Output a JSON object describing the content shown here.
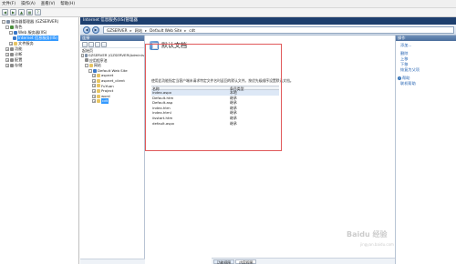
{
  "outer_menu": [
    "文件(F)",
    "操作(A)",
    "查看(V)",
    "帮助(H)"
  ],
  "left_tree": [
    {
      "label": "服务器管理器 (GZSERVER)",
      "depth": 0,
      "icon": "server-icon",
      "exp": "-"
    },
    {
      "label": "角色",
      "depth": 1,
      "icon": "role-icon",
      "exp": "-"
    },
    {
      "label": "Web 服务器(IIS)",
      "depth": 2,
      "icon": "iis-icon",
      "exp": "-"
    },
    {
      "label": "Internet 信息服务(IIS)",
      "depth": 3,
      "icon": "iis-icon",
      "exp": "",
      "selected": true
    },
    {
      "label": "文件服务",
      "depth": 2,
      "icon": "folder-icon",
      "exp": "+"
    },
    {
      "label": "功能",
      "depth": 1,
      "icon": "gear-icon",
      "exp": "+"
    },
    {
      "label": "诊断",
      "depth": 1,
      "icon": "gear-icon",
      "exp": "+"
    },
    {
      "label": "配置",
      "depth": 1,
      "icon": "gear-icon",
      "exp": "+"
    },
    {
      "label": "存储",
      "depth": 1,
      "icon": "gear-icon",
      "exp": "+"
    }
  ],
  "mmc": {
    "title": "Internet 信息服务(IIS)管理器",
    "breadcrumb": [
      "GZSERVER",
      "网站",
      "Default Web Site",
      "cdt"
    ]
  },
  "connections": {
    "header": "连接",
    "start_label": "起始页",
    "tree": [
      {
        "label": "GZSERVER (GZSERVER\\Adminis",
        "depth": 0,
        "exp": "-",
        "icon": "server-icon"
      },
      {
        "label": "应用程序池",
        "depth": 1,
        "exp": "",
        "icon": "gear-icon"
      },
      {
        "label": "网站",
        "depth": 1,
        "exp": "-",
        "icon": "folder-icon"
      },
      {
        "label": "Default Web Site",
        "depth": 2,
        "exp": "-",
        "icon": "iis-icon"
      },
      {
        "label": "aspnet",
        "depth": 3,
        "exp": "+",
        "icon": "folder-icon"
      },
      {
        "label": "aspnet_client",
        "depth": 3,
        "exp": "+",
        "icon": "folder-icon"
      },
      {
        "label": "FuYuan",
        "depth": 3,
        "exp": "+",
        "icon": "folder-icon"
      },
      {
        "label": "Project",
        "depth": 3,
        "exp": "+",
        "icon": "folder-icon"
      },
      {
        "label": "word",
        "depth": 3,
        "exp": "+",
        "icon": "folder-icon"
      },
      {
        "label": "cdt",
        "depth": 3,
        "exp": "+",
        "icon": "folder-icon",
        "selected": true
      }
    ]
  },
  "feature": {
    "title": "默认文档",
    "description": "使用此功能指定当客户端未请求特定文件名时返回的默认文件。按优先级顺序设置默认文档。",
    "columns": [
      "名称",
      "条目类型"
    ],
    "rows": [
      [
        "index.aspx",
        "本地"
      ],
      [
        "Default.htm",
        "继承"
      ],
      [
        "Default.asp",
        "继承"
      ],
      [
        "index.htm",
        "继承"
      ],
      [
        "index.html",
        "继承"
      ],
      [
        "iisstart.htm",
        "继承"
      ],
      [
        "default.aspx",
        "继承"
      ]
    ],
    "view_tabs": [
      "功能视图",
      "内容视图"
    ]
  },
  "actions": {
    "header": "操作",
    "items": [
      {
        "label": "添加...",
        "kind": "link"
      },
      {
        "label": "删除",
        "kind": "link"
      },
      {
        "label": "上移",
        "kind": "link"
      },
      {
        "label": "下移",
        "kind": "link"
      },
      {
        "label": "恢复为父项",
        "kind": "link"
      },
      {
        "label": "帮助",
        "kind": "help"
      },
      {
        "label": "联机帮助",
        "kind": "link"
      }
    ]
  },
  "watermark": {
    "main": "Baidu 经验",
    "sub": "jingyan.baidu.com"
  }
}
